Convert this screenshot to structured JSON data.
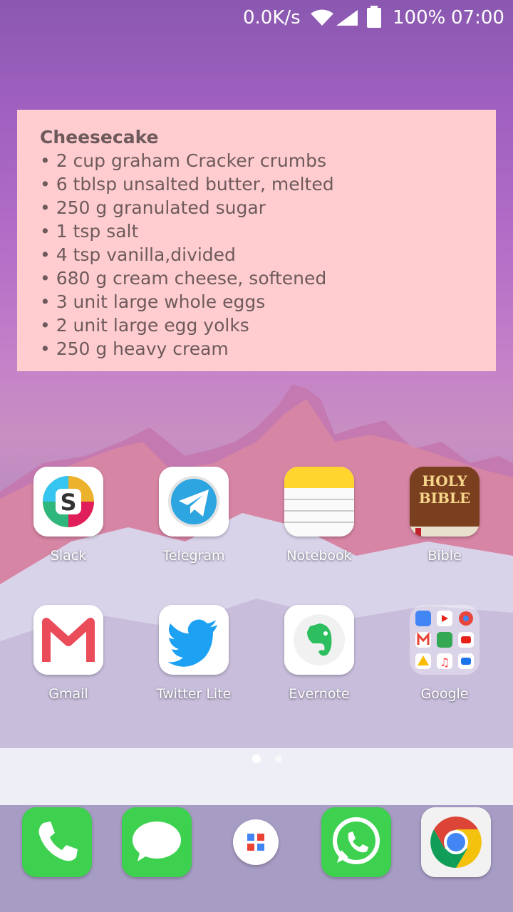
{
  "status_bar": {
    "speed": "0.0K/s",
    "battery": "100%",
    "time": "07:00"
  },
  "widget": {
    "title": "Cheesecake",
    "items": [
      "• 2 cup graham Cracker crumbs",
      "• 6 tblsp unsalted butter, melted",
      "• 250 g granulated sugar",
      "• 1 tsp salt",
      "• 4 tsp vanilla,divided",
      "• 680 g cream cheese, softened",
      "• 3 unit large whole eggs",
      "• 2 unit large egg yolks",
      "• 250 g heavy cream"
    ]
  },
  "apps": [
    {
      "label": "Slack",
      "icon": "slack-icon"
    },
    {
      "label": "Telegram",
      "icon": "telegram-icon"
    },
    {
      "label": "Notebook",
      "icon": "notebook-icon"
    },
    {
      "label": "Bible",
      "icon": "bible-icon",
      "icon_text": "HOLY BIBLE"
    },
    {
      "label": "Gmail",
      "icon": "gmail-icon"
    },
    {
      "label": "Twitter Lite",
      "icon": "twitter-icon"
    },
    {
      "label": "Evernote",
      "icon": "evernote-icon"
    },
    {
      "label": "Google",
      "icon": "google-folder-icon"
    }
  ],
  "dock": [
    {
      "icon": "phone-icon"
    },
    {
      "icon": "messages-icon"
    },
    {
      "icon": "app-drawer-icon"
    },
    {
      "icon": "whatsapp-icon"
    },
    {
      "icon": "chrome-icon"
    }
  ],
  "page_indicator": {
    "pages": 2,
    "current": 1
  }
}
